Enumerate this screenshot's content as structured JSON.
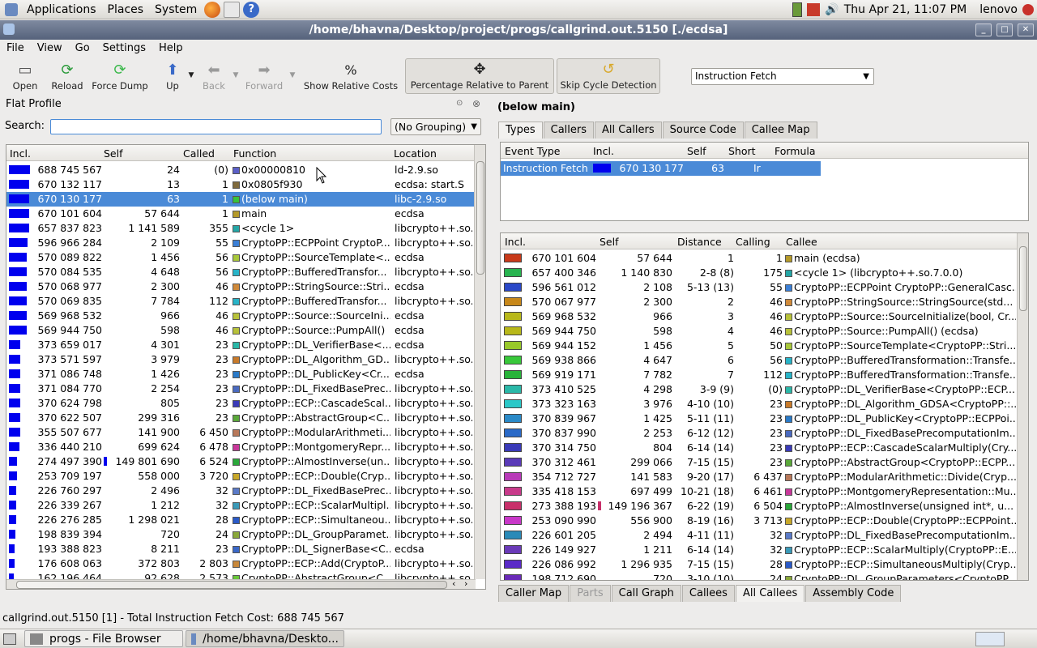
{
  "topbar": {
    "menus": [
      "Applications",
      "Places",
      "System"
    ],
    "datetime": "Thu Apr 21, 11:07 PM",
    "user": "lenovo"
  },
  "window": {
    "title": "/home/bhavna/Desktop/project/progs/callgrind.out.5150 [./ecdsa]"
  },
  "menubar": [
    "File",
    "View",
    "Go",
    "Settings",
    "Help"
  ],
  "toolbar": {
    "open": "Open",
    "reload": "Reload",
    "force_dump": "Force Dump",
    "up": "Up",
    "back": "Back",
    "forward": "Forward",
    "show_relative": "Show Relative Costs",
    "percentage": "Percentage Relative to Parent",
    "skip_cycle": "Skip Cycle Detection",
    "event_select": "Instruction Fetch"
  },
  "flat": {
    "title": "Flat Profile",
    "search_label": "Search:",
    "grouping": "(No Grouping)",
    "headers": [
      "Incl.",
      "Self",
      "Called",
      "Function",
      "Location"
    ],
    "rows": [
      {
        "incl": "688 745 567",
        "bar": 1.0,
        "self": "24",
        "called": "(0)",
        "color": "#5b5fc7",
        "func": "0x00000810",
        "loc": "ld-2.9.so"
      },
      {
        "incl": "670 132 117",
        "bar": 0.97,
        "self": "13",
        "called": "1",
        "color": "#7f6a3c",
        "func": "0x0805f930",
        "loc": "ecdsa: start.S"
      },
      {
        "incl": "670 130 177",
        "bar": 0.97,
        "self": "63",
        "called": "1",
        "color": "#38c23a",
        "func": "(below main)",
        "loc": "libc-2.9.so",
        "sel": true
      },
      {
        "incl": "670 101 604",
        "bar": 0.97,
        "self": "57 644",
        "called": "1",
        "color": "#b59a2a",
        "func": "main",
        "loc": "ecdsa"
      },
      {
        "incl": "657 837 823",
        "bar": 0.95,
        "self": "1 141 589",
        "called": "355",
        "color": "#24a6a6",
        "func": "<cycle 1>",
        "loc": "libcrypto++.so."
      },
      {
        "incl": "596 966 284",
        "bar": 0.87,
        "self": "2 109",
        "called": "55",
        "color": "#3b7fd6",
        "func": "CryptoPP::ECPPoint CryptoP...",
        "loc": "libcrypto++.so."
      },
      {
        "incl": "570 089 822",
        "bar": 0.83,
        "self": "1 456",
        "called": "56",
        "color": "#a8c83a",
        "func": "CryptoPP::SourceTemplate<...",
        "loc": "ecdsa"
      },
      {
        "incl": "570 084 535",
        "bar": 0.83,
        "self": "4 648",
        "called": "56",
        "color": "#28b4c8",
        "func": "CryptoPP::BufferedTransfor...",
        "loc": "libcrypto++.so."
      },
      {
        "incl": "570 068 977",
        "bar": 0.83,
        "self": "2 300",
        "called": "46",
        "color": "#d08a3a",
        "func": "CryptoPP::StringSource::Stri...",
        "loc": "ecdsa"
      },
      {
        "incl": "570 069 835",
        "bar": 0.83,
        "self": "7 784",
        "called": "112",
        "color": "#28b4c8",
        "func": "CryptoPP::BufferedTransfor...",
        "loc": "libcrypto++.so."
      },
      {
        "incl": "569 968 532",
        "bar": 0.83,
        "self": "966",
        "called": "46",
        "color": "#b8c23a",
        "func": "CryptoPP::Source::SourceIni...",
        "loc": "ecdsa"
      },
      {
        "incl": "569 944 750",
        "bar": 0.83,
        "self": "598",
        "called": "46",
        "color": "#b8c23a",
        "func": "CryptoPP::Source::PumpAll()",
        "loc": "ecdsa"
      },
      {
        "incl": "373 659 017",
        "bar": 0.54,
        "self": "4 301",
        "called": "23",
        "color": "#2ab8a8",
        "func": "CryptoPP::DL_VerifierBase<...",
        "loc": "ecdsa"
      },
      {
        "incl": "373 571 597",
        "bar": 0.54,
        "self": "3 979",
        "called": "23",
        "color": "#c87a2a",
        "func": "CryptoPP::DL_Algorithm_GD...",
        "loc": "libcrypto++.so."
      },
      {
        "incl": "371 086 748",
        "bar": 0.54,
        "self": "1 426",
        "called": "23",
        "color": "#2a7ac8",
        "func": "CryptoPP::DL_PublicKey<Cr...",
        "loc": "ecdsa"
      },
      {
        "incl": "371 084 770",
        "bar": 0.54,
        "self": "2 254",
        "called": "23",
        "color": "#4a6ac0",
        "func": "CryptoPP::DL_FixedBasePrec...",
        "loc": "libcrypto++.so."
      },
      {
        "incl": "370 624 798",
        "bar": 0.54,
        "self": "805",
        "called": "23",
        "color": "#3a3ab8",
        "func": "CryptoPP::ECP::CascadeScal...",
        "loc": "libcrypto++.so."
      },
      {
        "incl": "370 622 507",
        "bar": 0.54,
        "self": "299 316",
        "called": "23",
        "color": "#5aa83a",
        "func": "CryptoPP::AbstractGroup<C...",
        "loc": "libcrypto++.so."
      },
      {
        "incl": "355 507 677",
        "bar": 0.52,
        "self": "141 900",
        "called": "6 450",
        "color": "#b8785a",
        "func": "CryptoPP::ModularArithmeti...",
        "loc": "libcrypto++.so."
      },
      {
        "incl": "336 440 210",
        "bar": 0.49,
        "self": "699 624",
        "called": "6 478",
        "color": "#c8389a",
        "func": "CryptoPP::MontgomeryRepr...",
        "loc": "libcrypto++.so."
      },
      {
        "incl": "274 497 390",
        "bar": 0.4,
        "self": "149 801 690",
        "called": "6 524",
        "color": "#2aa83a",
        "func": "CryptoPP::AlmostInverse(un...",
        "loc": "libcrypto++.so.",
        "selfbar": true
      },
      {
        "incl": "253 709 197",
        "bar": 0.37,
        "self": "558 000",
        "called": "3 720",
        "color": "#c8a82a",
        "func": "CryptoPP::ECP::Double(Cryp...",
        "loc": "libcrypto++.so."
      },
      {
        "incl": "226 760 297",
        "bar": 0.33,
        "self": "2 496",
        "called": "32",
        "color": "#5a7ac8",
        "func": "CryptoPP::DL_FixedBasePrec...",
        "loc": "libcrypto++.so."
      },
      {
        "incl": "226 339 267",
        "bar": 0.33,
        "self": "1 212",
        "called": "32",
        "color": "#3a9ab8",
        "func": "CryptoPP::ECP::ScalarMultipl...",
        "loc": "libcrypto++.so."
      },
      {
        "incl": "226 276 285",
        "bar": 0.33,
        "self": "1 298 021",
        "called": "28",
        "color": "#2a5ac8",
        "func": "CryptoPP::ECP::Simultaneou...",
        "loc": "libcrypto++.so."
      },
      {
        "incl": "198 839 394",
        "bar": 0.29,
        "self": "720",
        "called": "24",
        "color": "#8aa83a",
        "func": "CryptoPP::DL_GroupParamet...",
        "loc": "libcrypto++.so."
      },
      {
        "incl": "193 388 823",
        "bar": 0.28,
        "self": "8 211",
        "called": "23",
        "color": "#3a68c8",
        "func": "CryptoPP::DL_SignerBase<C...",
        "loc": "ecdsa"
      },
      {
        "incl": "176 608 063",
        "bar": 0.26,
        "self": "372 803",
        "called": "2 803",
        "color": "#c8883a",
        "func": "CryptoPP::ECP::Add(CryptoP...",
        "loc": "libcrypto++.so."
      },
      {
        "incl": "162 196 464",
        "bar": 0.24,
        "self": "92 628",
        "called": "2 573",
        "color": "#6ac83a",
        "func": "CryptoPP::AbstractGroup<C...",
        "loc": "libcrypto++.so."
      }
    ]
  },
  "detail": {
    "title": "(below main)",
    "tabs": [
      "Types",
      "Callers",
      "All Callers",
      "Source Code",
      "Callee Map"
    ],
    "types_headers": [
      "Event Type",
      "Incl.",
      "Self",
      "Short",
      "Formula"
    ],
    "types_row": {
      "event": "Instruction Fetch",
      "incl": "670 130 177",
      "self": "63",
      "short": "Ir",
      "formula": ""
    },
    "callee_headers": [
      "Incl.",
      "Self",
      "Distance",
      "Calling",
      "Callee"
    ],
    "callees": [
      {
        "color": "#c83a1a",
        "incl": "670 101 604",
        "self": "57 644",
        "dist": "1",
        "calling": "1",
        "sq": "#b59a2a",
        "callee": "main (ecdsa)"
      },
      {
        "color": "#28b450",
        "incl": "657 400 346",
        "self": "1 140 830",
        "dist": "2-8 (8)",
        "calling": "175",
        "sq": "#24a6a6",
        "callee": "<cycle 1> (libcrypto++.so.7.0.0)"
      },
      {
        "color": "#2a48c8",
        "incl": "596 561 012",
        "self": "2 108",
        "dist": "5-13 (13)",
        "calling": "55",
        "sq": "#3b7fd6",
        "callee": "CryptoPP::ECPPoint CryptoPP::GeneralCasc..."
      },
      {
        "color": "#c8881a",
        "incl": "570 067 977",
        "self": "2 300",
        "dist": "2",
        "calling": "46",
        "sq": "#d08a3a",
        "callee": "CryptoPP::StringSource::StringSource(std..."
      },
      {
        "color": "#b8b81a",
        "incl": "569 968 532",
        "self": "966",
        "dist": "3",
        "calling": "46",
        "sq": "#b8c23a",
        "callee": "CryptoPP::Source::SourceInitialize(bool, Cr..."
      },
      {
        "color": "#b8b81a",
        "incl": "569 944 750",
        "self": "598",
        "dist": "4",
        "calling": "46",
        "sq": "#b8c23a",
        "callee": "CryptoPP::Source::PumpAll() (ecdsa)"
      },
      {
        "color": "#98c82a",
        "incl": "569 944 152",
        "self": "1 456",
        "dist": "5",
        "calling": "50",
        "sq": "#a8c83a",
        "callee": "CryptoPP::SourceTemplate<CryptoPP::Stri..."
      },
      {
        "color": "#38c83a",
        "incl": "569 938 866",
        "self": "4 647",
        "dist": "6",
        "calling": "56",
        "sq": "#28b4c8",
        "callee": "CryptoPP::BufferedTransformation::Transfe..."
      },
      {
        "color": "#28b43a",
        "incl": "569 919 171",
        "self": "7 782",
        "dist": "7",
        "calling": "112",
        "sq": "#28b4c8",
        "callee": "CryptoPP::BufferedTransformation::Transfe..."
      },
      {
        "color": "#2ab8a8",
        "incl": "373 410 525",
        "self": "4 298",
        "dist": "3-9 (9)",
        "calling": "(0)",
        "sq": "#2ab8a8",
        "callee": "CryptoPP::DL_VerifierBase<CryptoPP::ECP..."
      },
      {
        "color": "#2ac8c8",
        "incl": "373 323 163",
        "self": "3 976",
        "dist": "4-10 (10)",
        "calling": "23",
        "sq": "#c87a2a",
        "callee": "CryptoPP::DL_Algorithm_GDSA<CryptoPP::..."
      },
      {
        "color": "#2a8ac8",
        "incl": "370 839 967",
        "self": "1 425",
        "dist": "5-11 (11)",
        "calling": "23",
        "sq": "#2a7ac8",
        "callee": "CryptoPP::DL_PublicKey<CryptoPP::ECPPoi..."
      },
      {
        "color": "#2a6ac8",
        "incl": "370 837 990",
        "self": "2 253",
        "dist": "6-12 (12)",
        "calling": "23",
        "sq": "#4a6ac0",
        "callee": "CryptoPP::DL_FixedBasePrecomputationIm..."
      },
      {
        "color": "#3a3ab8",
        "incl": "370 314 750",
        "self": "804",
        "dist": "6-14 (14)",
        "calling": "23",
        "sq": "#3a3ab8",
        "callee": "CryptoPP::ECP::CascadeScalarMultiply(Cry..."
      },
      {
        "color": "#5a3ab8",
        "incl": "370 312 461",
        "self": "299 066",
        "dist": "7-15 (15)",
        "calling": "23",
        "sq": "#5aa83a",
        "callee": "CryptoPP::AbstractGroup<CryptoPP::ECPP..."
      },
      {
        "color": "#b83ab8",
        "incl": "354 712 727",
        "self": "141 583",
        "dist": "9-20 (17)",
        "calling": "6 437",
        "sq": "#b8785a",
        "callee": "CryptoPP::ModularArithmetic::Divide(Cryp..."
      },
      {
        "color": "#c83a8a",
        "incl": "335 418 153",
        "self": "697 499",
        "dist": "10-21 (18)",
        "calling": "6 461",
        "sq": "#c8389a",
        "callee": "CryptoPP::MontgomeryRepresentation::Mu..."
      },
      {
        "color": "#c8306a",
        "incl": "273 388 193",
        "self": "149 196 367",
        "dist": "6-22 (19)",
        "calling": "6 504",
        "sq": "#2aa83a",
        "callee": "CryptoPP::AlmostInverse(unsigned int*, u...",
        "selfbar": true
      },
      {
        "color": "#c838c8",
        "incl": "253 090 990",
        "self": "556 900",
        "dist": "8-19 (16)",
        "calling": "3 713",
        "sq": "#c8a82a",
        "callee": "CryptoPP::ECP::Double(CryptoPP::ECPPoint..."
      },
      {
        "color": "#2a8ab8",
        "incl": "226 601 205",
        "self": "2 494",
        "dist": "4-11 (11)",
        "calling": "32",
        "sq": "#5a7ac8",
        "callee": "CryptoPP::DL_FixedBasePrecomputationIm..."
      },
      {
        "color": "#6a3ab8",
        "incl": "226 149 927",
        "self": "1 211",
        "dist": "6-14 (14)",
        "calling": "32",
        "sq": "#3a9ab8",
        "callee": "CryptoPP::ECP::ScalarMultiply(CryptoPP::E..."
      },
      {
        "color": "#5a2ac8",
        "incl": "226 086 992",
        "self": "1 296 935",
        "dist": "7-15 (15)",
        "calling": "28",
        "sq": "#2a5ac8",
        "callee": "CryptoPP::ECP::SimultaneousMultiply(Cryp..."
      },
      {
        "color": "#6a2ab8",
        "incl": "198 712 690",
        "self": "720",
        "dist": "3-10 (10)",
        "calling": "24",
        "sq": "#8aa83a",
        "callee": "CryptoPP::DL_GroupParameters<CryptoPP..."
      }
    ],
    "bottom_tabs": [
      "Caller Map",
      "Parts",
      "Call Graph",
      "Callees",
      "All Callees",
      "Assembly Code"
    ]
  },
  "status": "callgrind.out.5150 [1] - Total Instruction Fetch Cost:  688 745 567",
  "taskbar": {
    "task1": "progs - File Browser",
    "task2": "/home/bhavna/Deskto..."
  }
}
